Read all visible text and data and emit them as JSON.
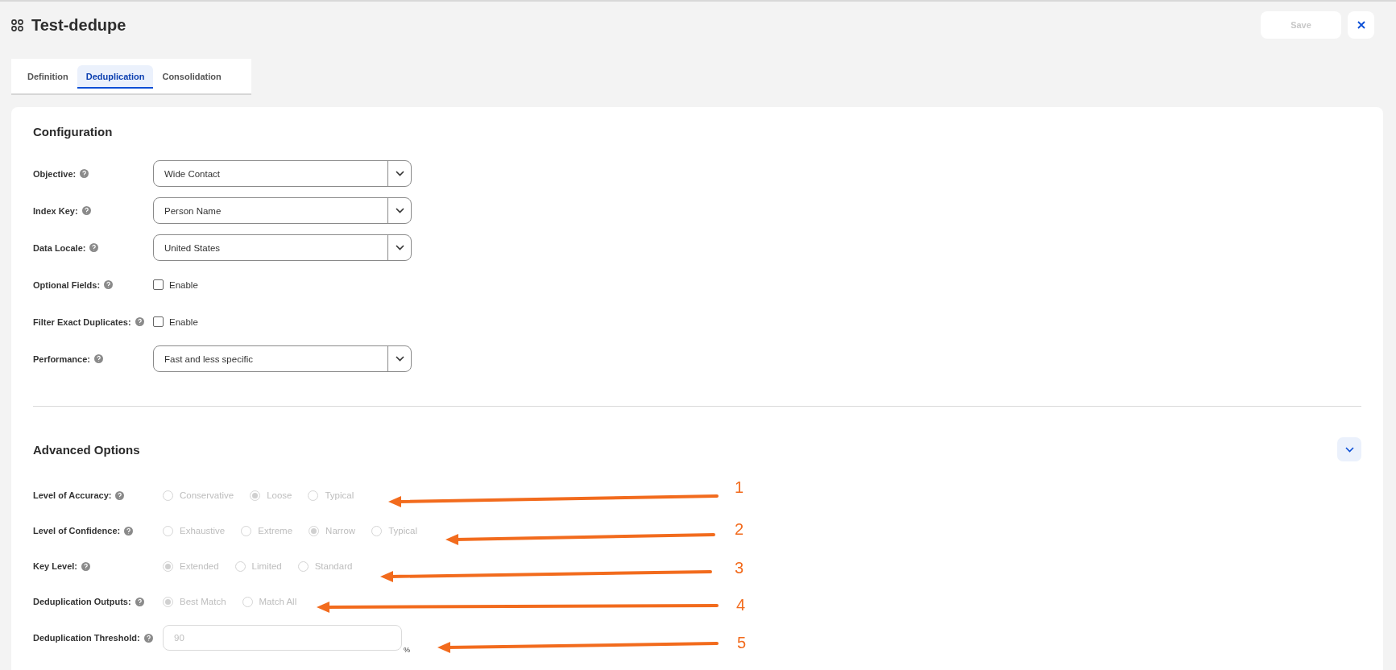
{
  "header": {
    "title": "Test-dedupe",
    "save": {
      "label": "Save",
      "disabled": true
    }
  },
  "tabs": [
    {
      "label": "Definition",
      "selected": false
    },
    {
      "label": "Deduplication",
      "selected": true
    },
    {
      "label": "Consolidation",
      "selected": false
    }
  ],
  "configuration": {
    "title": "Configuration",
    "fields": [
      {
        "kind": "select",
        "label": "Objective:",
        "value": "Wide Contact"
      },
      {
        "kind": "select",
        "label": "Index Key:",
        "value": "Person Name"
      },
      {
        "kind": "select",
        "label": "Data Locale:",
        "value": "United States"
      },
      {
        "kind": "checkbox",
        "label": "Optional Fields:",
        "option": "Enable",
        "checked": false
      },
      {
        "kind": "checkbox",
        "label": "Filter Exact Duplicates:",
        "option": "Enable",
        "checked": false
      },
      {
        "kind": "select",
        "label": "Performance:",
        "value": "Fast and less specific"
      }
    ]
  },
  "advanced": {
    "title": "Advanced Options",
    "expanded": true,
    "disabled": true,
    "fields": [
      {
        "kind": "radio",
        "label": "Level of Accuracy:",
        "options": [
          {
            "label": "Conservative",
            "selected": false
          },
          {
            "label": "Loose",
            "selected": true
          },
          {
            "label": "Typical",
            "selected": false
          }
        ]
      },
      {
        "kind": "radio",
        "label": "Level of Confidence:",
        "options": [
          {
            "label": "Exhaustive",
            "selected": false
          },
          {
            "label": "Extreme",
            "selected": false
          },
          {
            "label": "Narrow",
            "selected": true
          },
          {
            "label": "Typical",
            "selected": false
          }
        ]
      },
      {
        "kind": "radio",
        "label": "Key Level:",
        "options": [
          {
            "label": "Extended",
            "selected": true
          },
          {
            "label": "Limited",
            "selected": false
          },
          {
            "label": "Standard",
            "selected": false
          }
        ]
      },
      {
        "kind": "radio",
        "label": "Deduplication Outputs:",
        "options": [
          {
            "label": "Best Match",
            "selected": true
          },
          {
            "label": "Match All",
            "selected": false
          }
        ]
      },
      {
        "kind": "number",
        "label": "Deduplication Threshold:",
        "value": "90",
        "unit": "%"
      }
    ]
  },
  "annotations": [
    {
      "number": "1"
    },
    {
      "number": "2"
    },
    {
      "number": "3"
    },
    {
      "number": "4"
    },
    {
      "number": "5"
    }
  ]
}
